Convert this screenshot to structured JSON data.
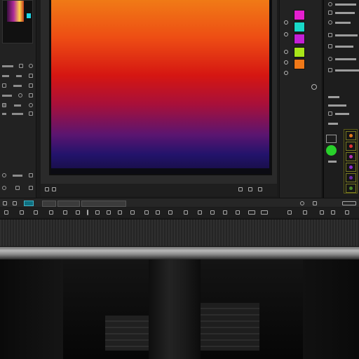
{
  "canvas": {
    "status_left": "",
    "status_right": "",
    "gradient_colors": [
      "#f07a16",
      "#d51612",
      "#5b1570",
      "#1a0f4d"
    ]
  },
  "swatches": [
    {
      "color": "#e51fd0"
    },
    {
      "color": "#19d9c8"
    },
    {
      "color": "#c41fd6"
    },
    {
      "color": "#a8e61a"
    },
    {
      "color": "#f07818"
    }
  ],
  "layers": [
    {
      "color": "#e0791b"
    },
    {
      "color": "#d33"
    },
    {
      "color": "#b030b0"
    },
    {
      "color": "#8a2bd0"
    },
    {
      "color": "#6a2aa8"
    },
    {
      "color": "#4a8a2a"
    }
  ],
  "accent_color": "#29d12b",
  "icons": {
    "left_panel": [
      "layers-icon",
      "eye-icon",
      "settings-icon",
      "lock-icon",
      "link-icon",
      "trash-icon"
    ],
    "toolbar": [
      "brush-icon",
      "eraser-icon",
      "crop-icon",
      "zoom-icon",
      "hand-icon",
      "undo-icon",
      "redo-icon"
    ]
  }
}
